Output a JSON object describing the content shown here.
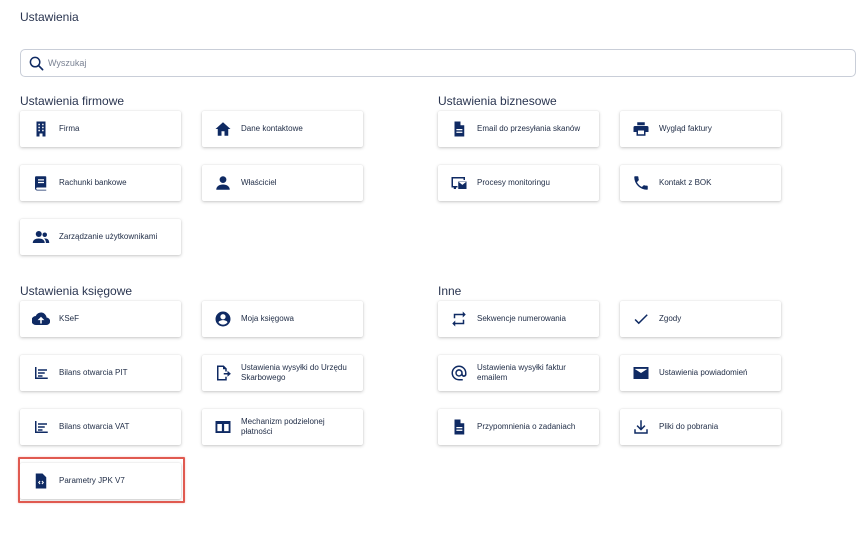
{
  "page": {
    "title": "Ustawienia"
  },
  "search": {
    "placeholder": "Wyszukaj"
  },
  "sections": {
    "firmowe": {
      "title": "Ustawienia firmowe",
      "items": [
        "Firma",
        "Dane kontaktowe",
        "Rachunki bankowe",
        "Właściciel",
        "Zarządzanie użytkownikami"
      ]
    },
    "biznesowe": {
      "title": "Ustawienia biznesowe",
      "items": [
        "Email do przesyłania skanów",
        "Wygląd faktury",
        "Procesy monitoringu",
        "Kontakt z BOK"
      ]
    },
    "ksiegowe": {
      "title": "Ustawienia księgowe",
      "items": [
        "KSeF",
        "Moja księgowa",
        "Bilans otwarcia PIT",
        "Ustawienia wysyłki do Urzędu Skarbowego",
        "Bilans otwarcia VAT",
        "Mechanizm podzielonej płatności",
        "Parametry JPK V7"
      ]
    },
    "inne": {
      "title": "Inne",
      "items": [
        "Sekwencje numerowania",
        "Zgody",
        "Ustawienia wysyłki faktur emailem",
        "Ustawienia powiadomień",
        "Przypomnienia o zadaniach",
        "Pliki do pobrania"
      ]
    }
  },
  "colors": {
    "icon": "#0f2a63",
    "highlight": "#e05a50"
  },
  "icons": {
    "firma": "building-icon",
    "dane": "home-icon",
    "rachunki": "book-icon",
    "wlasciciel": "person-icon",
    "uzytkownicy": "people-icon",
    "email": "document-icon",
    "wyglad": "printer-icon",
    "procesy": "monitor-mail-icon",
    "bok": "phone-icon",
    "ksef": "cloud-upload-icon",
    "ksiegowa": "account-circle-icon",
    "bilans": "list-icon",
    "wysylka_us": "export-icon",
    "mechanizm": "split-columns-icon",
    "jpk": "code-file-icon",
    "sekwencje": "repeat-icon",
    "zgody": "check-icon",
    "wysylka_email": "at-icon",
    "powiadomienia": "envelope-icon",
    "przypomnienia": "document-icon",
    "pliki": "download-icon"
  }
}
